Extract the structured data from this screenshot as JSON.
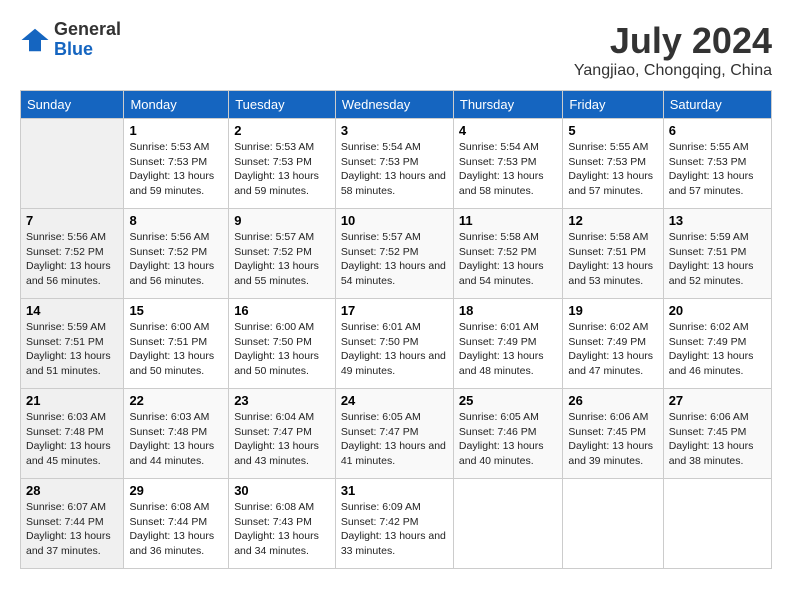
{
  "header": {
    "logo_line1": "General",
    "logo_line2": "Blue",
    "title": "July 2024",
    "subtitle": "Yangjiao, Chongqing, China"
  },
  "columns": [
    "Sunday",
    "Monday",
    "Tuesday",
    "Wednesday",
    "Thursday",
    "Friday",
    "Saturday"
  ],
  "weeks": [
    [
      {
        "day": "",
        "rise": "",
        "set": "",
        "daylight": ""
      },
      {
        "day": "1",
        "rise": "Sunrise: 5:53 AM",
        "set": "Sunset: 7:53 PM",
        "daylight": "Daylight: 13 hours and 59 minutes."
      },
      {
        "day": "2",
        "rise": "Sunrise: 5:53 AM",
        "set": "Sunset: 7:53 PM",
        "daylight": "Daylight: 13 hours and 59 minutes."
      },
      {
        "day": "3",
        "rise": "Sunrise: 5:54 AM",
        "set": "Sunset: 7:53 PM",
        "daylight": "Daylight: 13 hours and 58 minutes."
      },
      {
        "day": "4",
        "rise": "Sunrise: 5:54 AM",
        "set": "Sunset: 7:53 PM",
        "daylight": "Daylight: 13 hours and 58 minutes."
      },
      {
        "day": "5",
        "rise": "Sunrise: 5:55 AM",
        "set": "Sunset: 7:53 PM",
        "daylight": "Daylight: 13 hours and 57 minutes."
      },
      {
        "day": "6",
        "rise": "Sunrise: 5:55 AM",
        "set": "Sunset: 7:53 PM",
        "daylight": "Daylight: 13 hours and 57 minutes."
      }
    ],
    [
      {
        "day": "7",
        "rise": "Sunrise: 5:56 AM",
        "set": "Sunset: 7:52 PM",
        "daylight": "Daylight: 13 hours and 56 minutes."
      },
      {
        "day": "8",
        "rise": "Sunrise: 5:56 AM",
        "set": "Sunset: 7:52 PM",
        "daylight": "Daylight: 13 hours and 56 minutes."
      },
      {
        "day": "9",
        "rise": "Sunrise: 5:57 AM",
        "set": "Sunset: 7:52 PM",
        "daylight": "Daylight: 13 hours and 55 minutes."
      },
      {
        "day": "10",
        "rise": "Sunrise: 5:57 AM",
        "set": "Sunset: 7:52 PM",
        "daylight": "Daylight: 13 hours and 54 minutes."
      },
      {
        "day": "11",
        "rise": "Sunrise: 5:58 AM",
        "set": "Sunset: 7:52 PM",
        "daylight": "Daylight: 13 hours and 54 minutes."
      },
      {
        "day": "12",
        "rise": "Sunrise: 5:58 AM",
        "set": "Sunset: 7:51 PM",
        "daylight": "Daylight: 13 hours and 53 minutes."
      },
      {
        "day": "13",
        "rise": "Sunrise: 5:59 AM",
        "set": "Sunset: 7:51 PM",
        "daylight": "Daylight: 13 hours and 52 minutes."
      }
    ],
    [
      {
        "day": "14",
        "rise": "Sunrise: 5:59 AM",
        "set": "Sunset: 7:51 PM",
        "daylight": "Daylight: 13 hours and 51 minutes."
      },
      {
        "day": "15",
        "rise": "Sunrise: 6:00 AM",
        "set": "Sunset: 7:51 PM",
        "daylight": "Daylight: 13 hours and 50 minutes."
      },
      {
        "day": "16",
        "rise": "Sunrise: 6:00 AM",
        "set": "Sunset: 7:50 PM",
        "daylight": "Daylight: 13 hours and 50 minutes."
      },
      {
        "day": "17",
        "rise": "Sunrise: 6:01 AM",
        "set": "Sunset: 7:50 PM",
        "daylight": "Daylight: 13 hours and 49 minutes."
      },
      {
        "day": "18",
        "rise": "Sunrise: 6:01 AM",
        "set": "Sunset: 7:49 PM",
        "daylight": "Daylight: 13 hours and 48 minutes."
      },
      {
        "day": "19",
        "rise": "Sunrise: 6:02 AM",
        "set": "Sunset: 7:49 PM",
        "daylight": "Daylight: 13 hours and 47 minutes."
      },
      {
        "day": "20",
        "rise": "Sunrise: 6:02 AM",
        "set": "Sunset: 7:49 PM",
        "daylight": "Daylight: 13 hours and 46 minutes."
      }
    ],
    [
      {
        "day": "21",
        "rise": "Sunrise: 6:03 AM",
        "set": "Sunset: 7:48 PM",
        "daylight": "Daylight: 13 hours and 45 minutes."
      },
      {
        "day": "22",
        "rise": "Sunrise: 6:03 AM",
        "set": "Sunset: 7:48 PM",
        "daylight": "Daylight: 13 hours and 44 minutes."
      },
      {
        "day": "23",
        "rise": "Sunrise: 6:04 AM",
        "set": "Sunset: 7:47 PM",
        "daylight": "Daylight: 13 hours and 43 minutes."
      },
      {
        "day": "24",
        "rise": "Sunrise: 6:05 AM",
        "set": "Sunset: 7:47 PM",
        "daylight": "Daylight: 13 hours and 41 minutes."
      },
      {
        "day": "25",
        "rise": "Sunrise: 6:05 AM",
        "set": "Sunset: 7:46 PM",
        "daylight": "Daylight: 13 hours and 40 minutes."
      },
      {
        "day": "26",
        "rise": "Sunrise: 6:06 AM",
        "set": "Sunset: 7:45 PM",
        "daylight": "Daylight: 13 hours and 39 minutes."
      },
      {
        "day": "27",
        "rise": "Sunrise: 6:06 AM",
        "set": "Sunset: 7:45 PM",
        "daylight": "Daylight: 13 hours and 38 minutes."
      }
    ],
    [
      {
        "day": "28",
        "rise": "Sunrise: 6:07 AM",
        "set": "Sunset: 7:44 PM",
        "daylight": "Daylight: 13 hours and 37 minutes."
      },
      {
        "day": "29",
        "rise": "Sunrise: 6:08 AM",
        "set": "Sunset: 7:44 PM",
        "daylight": "Daylight: 13 hours and 36 minutes."
      },
      {
        "day": "30",
        "rise": "Sunrise: 6:08 AM",
        "set": "Sunset: 7:43 PM",
        "daylight": "Daylight: 13 hours and 34 minutes."
      },
      {
        "day": "31",
        "rise": "Sunrise: 6:09 AM",
        "set": "Sunset: 7:42 PM",
        "daylight": "Daylight: 13 hours and 33 minutes."
      },
      {
        "day": "",
        "rise": "",
        "set": "",
        "daylight": ""
      },
      {
        "day": "",
        "rise": "",
        "set": "",
        "daylight": ""
      },
      {
        "day": "",
        "rise": "",
        "set": "",
        "daylight": ""
      }
    ]
  ]
}
